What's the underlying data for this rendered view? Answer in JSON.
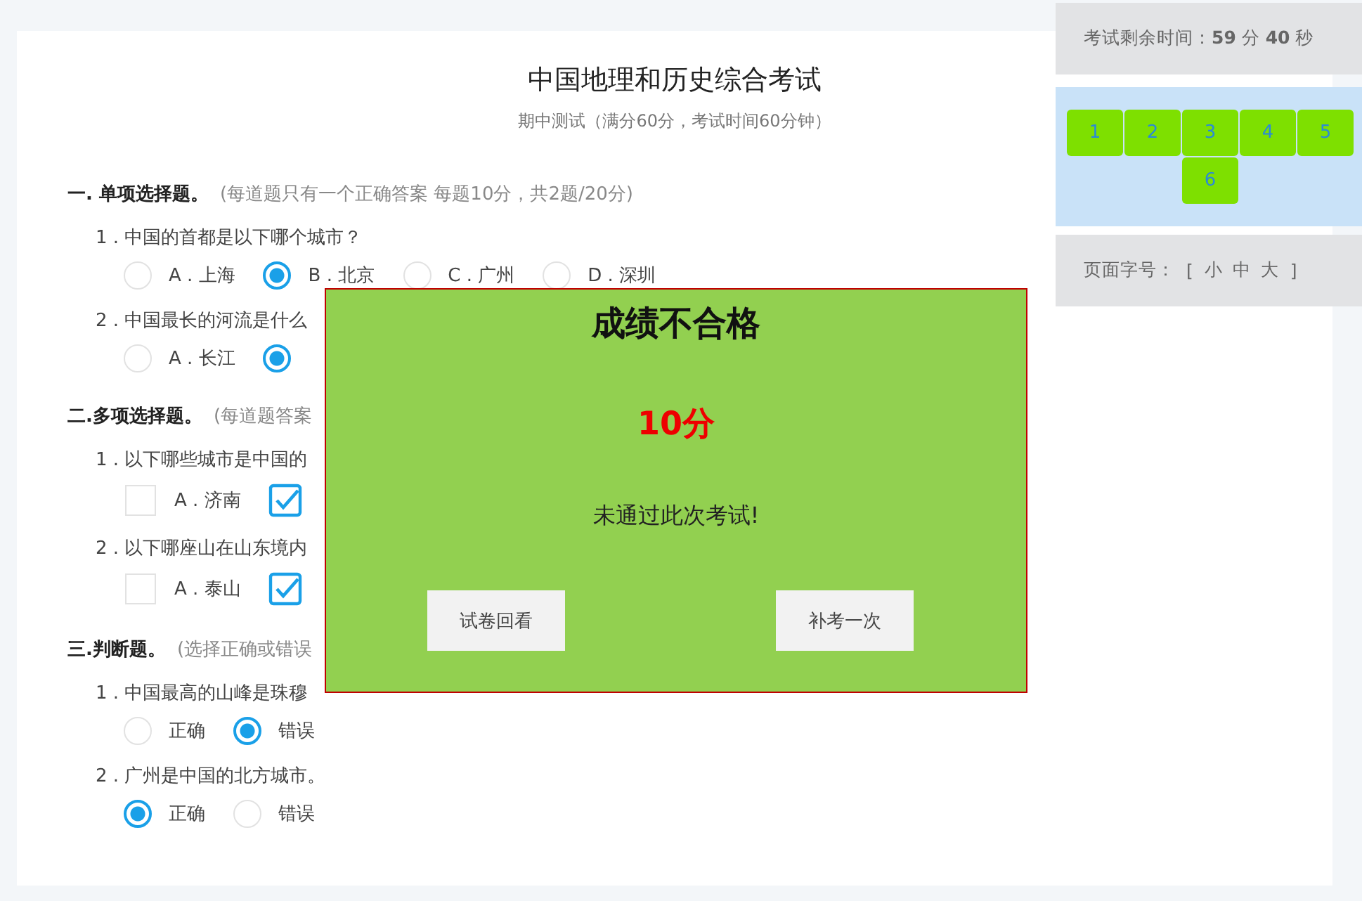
{
  "exam": {
    "title": "中国地理和历史综合考试",
    "subtitle": "期中测试（满分60分，考试时间60分钟）"
  },
  "sections": [
    {
      "heading": "一. 单项选择题。",
      "note": "(每道题只有一个正确答案 每题10分，共2题/20分)",
      "questions": [
        {
          "text": "1 . 中国的首都是以下哪个城市？",
          "kind": "radio",
          "options": [
            {
              "label": "A . 上海",
              "selected": false
            },
            {
              "label": "B . 北京",
              "selected": true
            },
            {
              "label": "C . 广州",
              "selected": false
            },
            {
              "label": "D . 深圳",
              "selected": false
            }
          ]
        },
        {
          "text": "2 . 中国最长的河流是什么",
          "kind": "radio",
          "options": [
            {
              "label": "A . 长江",
              "selected": false
            },
            {
              "selected": true
            }
          ]
        }
      ]
    },
    {
      "heading": "二.多项选择题。",
      "note": "(每道题答案",
      "questions": [
        {
          "text": "1 . 以下哪些城市是中国的",
          "kind": "checkbox",
          "options": [
            {
              "label": "A . 济南",
              "selected": false
            },
            {
              "selected": true
            }
          ]
        },
        {
          "text": "2 . 以下哪座山在山东境内",
          "kind": "checkbox",
          "options": [
            {
              "label": "A . 泰山",
              "selected": false
            },
            {
              "selected": true
            }
          ]
        }
      ]
    },
    {
      "heading": "三.判断题。",
      "note": "(选择正确或错误",
      "questions": [
        {
          "text": "1 . 中国最高的山峰是珠穆",
          "kind": "radio",
          "options": [
            {
              "label": "正确",
              "selected": false
            },
            {
              "label": "错误",
              "selected": true
            }
          ]
        },
        {
          "text": "2 . 广州是中国的北方城市。",
          "kind": "radio",
          "options": [
            {
              "label": "正确",
              "selected": true
            },
            {
              "label": "错误",
              "selected": false
            }
          ]
        }
      ]
    }
  ],
  "sidebar": {
    "timer": "考试剩余时间：**59** 分 **40** 秒",
    "question_nav": [
      "1",
      "2",
      "3",
      "4",
      "5",
      "6"
    ],
    "font_size": {
      "label": "页面字号：",
      "open": "[",
      "sizes": [
        "小",
        "中",
        "大"
      ],
      "close": "]"
    }
  },
  "result_dialog": {
    "title": "成绩不合格",
    "score": "10分",
    "message": "未通过此次考试!",
    "buttons": [
      "试卷回看",
      "补考一次"
    ]
  }
}
